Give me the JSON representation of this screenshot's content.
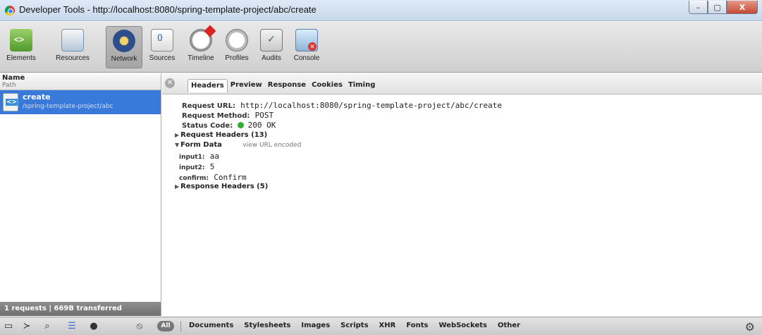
{
  "window": {
    "title": "Developer Tools - http://localhost:8080/spring-template-project/abc/create",
    "controls": [
      "–",
      "▢",
      "X"
    ]
  },
  "toolbar": {
    "panels": [
      {
        "label": "Elements",
        "icon": "elements-icon"
      },
      {
        "label": "Resources",
        "icon": "resources-icon"
      },
      {
        "label": "Network",
        "icon": "network-icon",
        "active": true
      },
      {
        "label": "Sources",
        "icon": "sources-icon"
      },
      {
        "label": "Timeline",
        "icon": "timeline-icon"
      },
      {
        "label": "Profiles",
        "icon": "profiles-icon"
      },
      {
        "label": "Audits",
        "icon": "audits-icon"
      },
      {
        "label": "Console",
        "icon": "console-icon"
      }
    ]
  },
  "request_list": {
    "col_name": "Name",
    "col_path": "Path",
    "items": [
      {
        "name": "create",
        "path": "/spring-template-project/abc"
      }
    ],
    "summary": "1 requests  |  669B transferred"
  },
  "details": {
    "tabs": [
      "Headers",
      "Preview",
      "Response",
      "Cookies",
      "Timing"
    ],
    "active_tab": "Headers",
    "request_url_label": "Request URL:",
    "request_url": "http://localhost:8080/spring-template-project/abc/create",
    "request_method_label": "Request Method:",
    "request_method": "POST",
    "status_code_label": "Status Code:",
    "status_code": "200 OK",
    "request_headers": "Request Headers (13)",
    "form_data": "Form Data",
    "form_data_toggle": "view URL encoded",
    "form_fields": [
      {
        "key": "input1:",
        "value": "aa"
      },
      {
        "key": "input2:",
        "value": "5"
      },
      {
        "key": "confirm:",
        "value": "Confirm"
      }
    ],
    "response_headers": "Response Headers (5)"
  },
  "statusbar": {
    "all_label": "All",
    "filters": [
      "Documents",
      "Stylesheets",
      "Images",
      "Scripts",
      "XHR",
      "Fonts",
      "WebSockets",
      "Other"
    ]
  }
}
